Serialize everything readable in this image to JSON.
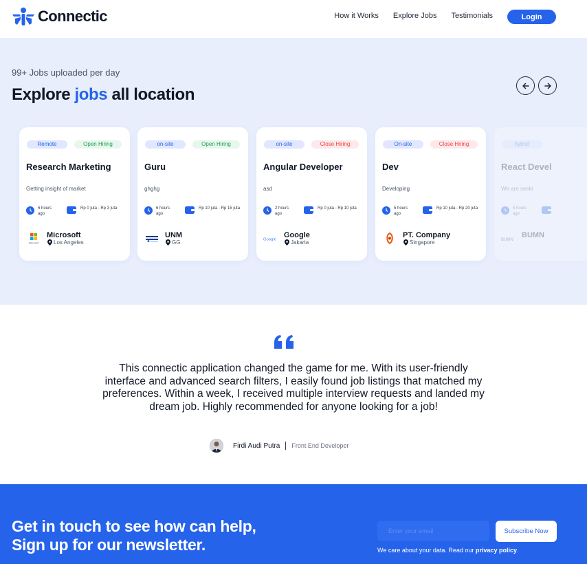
{
  "header": {
    "brand": "Connectic",
    "nav": [
      "How it Works",
      "Explore Jobs",
      "Testimonials"
    ],
    "login_label": "Login"
  },
  "jobs": {
    "subtitle": "99+ Jobs uploaded per day",
    "heading_pre": "Explore ",
    "heading_accent": "jobs",
    "heading_post": " all location",
    "cards": [
      {
        "type": "Remote",
        "status": "Open Hiring",
        "status_kind": "open",
        "title": "Research Marketing",
        "desc": "Getting insight of market",
        "time": "6 hours ago",
        "salary": "Rp 0 juta - Rp 3 juta",
        "company": "Microsoft",
        "logo_text": "Microsoft",
        "location": "Los Angeles"
      },
      {
        "type": "on-site",
        "status": "Open Hiring",
        "status_kind": "open",
        "title": "Guru",
        "desc": "ghghg",
        "time": "6 hours ago",
        "salary": "Rp 10 juta - Rp 15 juta",
        "company": "UNM",
        "logo_text": "UNM",
        "location": "GG"
      },
      {
        "type": "on-site",
        "status": "Close Hiring",
        "status_kind": "close",
        "title": "Angular Developer",
        "desc": "asd",
        "time": "2 hours ago",
        "salary": "Rp 0 juta - Rp 10 juta",
        "company": "Google",
        "logo_text": "Google",
        "location": "Jakarta"
      },
      {
        "type": "On-site",
        "status": "Close Hiring",
        "status_kind": "close",
        "title": "Dev",
        "desc": "Developing",
        "time": "5 hours ago",
        "salary": "Rp 10 juta - Rp 20 juta",
        "company": "PT. Company",
        "logo_text": "",
        "location": "Singapore"
      },
      {
        "type": "hybrid",
        "status": "",
        "status_kind": "",
        "title": "React Devel",
        "desc": "We are seeki",
        "time": "5 hours ago",
        "salary": "",
        "company": "BUMN",
        "logo_text": "BUMN",
        "location": ""
      }
    ]
  },
  "testimonial": {
    "quote": "This connectic application changed the game for me. With its user-friendly interface and advanced search filters, I easily found job listings that matched my preferences. Within a week, I received multiple interview requests and landed my dream job. Highly recommended for anyone looking for a job!",
    "author_name": "Firdi Audi Putra",
    "author_role": "Front End Developer"
  },
  "newsletter": {
    "title_line1": "Get in touch to see how can help,",
    "title_line2": "Sign up for our newsletter.",
    "email_placeholder": "Enter your email",
    "subscribe_label": "Subscribe Now",
    "privacy_pre": "We care about your data. Read our ",
    "privacy_link": "privacy policy",
    "privacy_post": "."
  },
  "colors": {
    "primary": "#2563eb",
    "section_bg": "#e8eefc",
    "open": "#16a34a",
    "close": "#ef4444"
  }
}
